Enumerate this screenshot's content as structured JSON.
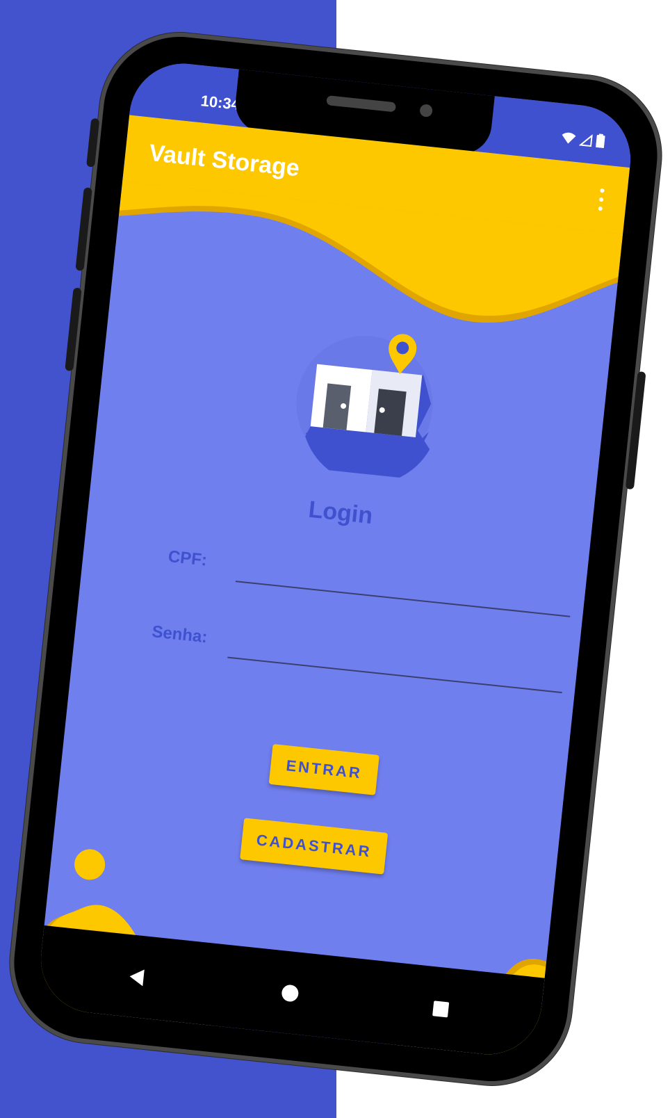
{
  "status_bar": {
    "time": "10:34",
    "icons": [
      "wifi-icon",
      "signal-icon",
      "battery-icon"
    ]
  },
  "app_bar": {
    "title": "Vault Storage",
    "menu_icon": "overflow-menu-icon"
  },
  "login": {
    "logo_icon": "storage-location-logo-icon",
    "title": "Login",
    "cpf_label": "CPF:",
    "cpf_value": "",
    "senha_label": "Senha:",
    "senha_value": "",
    "entrar_label": "ENTRAR",
    "cadastrar_label": "CADASTRAR"
  },
  "nav_bar": {
    "icons": [
      "back-icon",
      "home-icon",
      "recents-icon"
    ]
  },
  "colors": {
    "background_left": "#4352cd",
    "background_right": "#ffffff",
    "primary_blue": "#3f51cf",
    "screen_bg": "#707fee",
    "accent_yellow": "#fdc800",
    "dark_yellow": "#e0a500"
  }
}
